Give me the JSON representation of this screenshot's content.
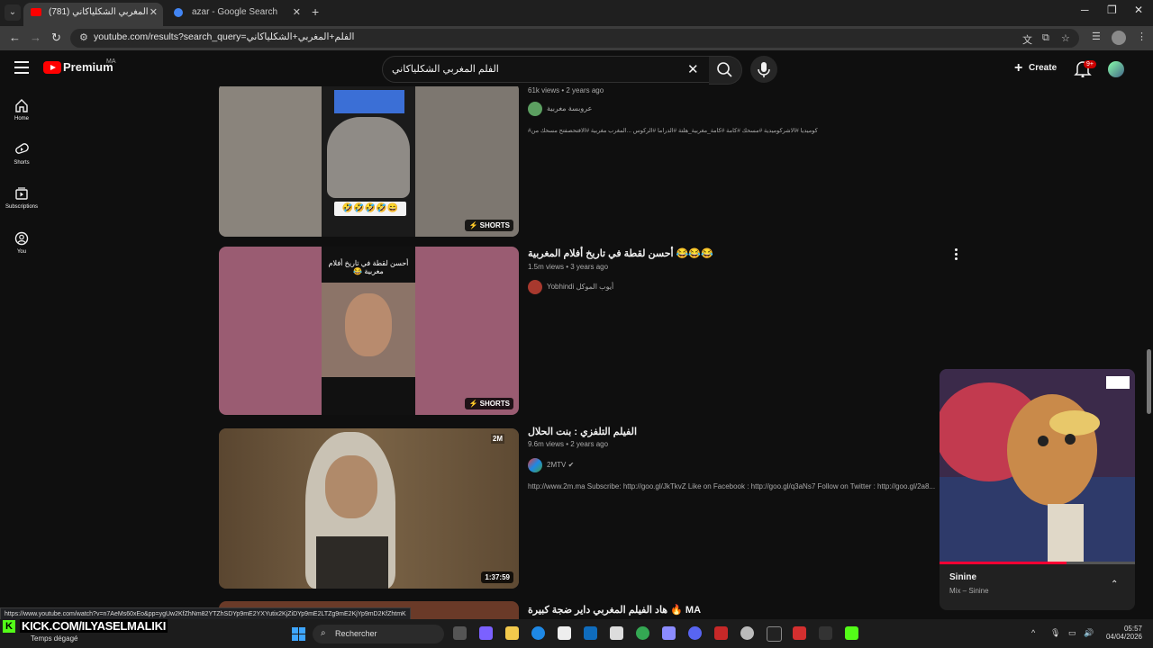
{
  "browser": {
    "tabs": [
      {
        "title": "(781) الفلم المغربي الشكلياكاني",
        "active": true
      },
      {
        "title": "azar - Google Search",
        "active": false
      }
    ],
    "url": "youtube.com/results?search_query=الفلم+المغربي+الشكلياكاني",
    "status_url": "https://www.youtube.com/watch?v=n7AeMs60xEo&pp=ygUw2KfZhNm82YTZhSDYp9mE2YXYutix2KjZiDYp9mE2LTZg9mE2KjYp9mD2KfZhtmK"
  },
  "youtube": {
    "premium_label": "Premium",
    "country": "MA",
    "search_query": "الفلم المغربي الشكلياكاني",
    "create_label": "Create",
    "notification_count": "9+",
    "sidebar": [
      {
        "label": "Home",
        "icon": "home-icon"
      },
      {
        "label": "Shorts",
        "icon": "shorts-icon"
      },
      {
        "label": "Subscriptions",
        "icon": "subscriptions-icon"
      },
      {
        "label": "You",
        "icon": "you-icon"
      }
    ],
    "results": [
      {
        "meta": "61k views • 2 years ago",
        "channel": "عروبسة مغربية",
        "description": "#كوميديا #الاشركوميدية #مسحك #كامة #كامة_مغربية_هلتة #الدراما #الركوس ...المغرب مغربية #الافتحصفتح مسحك من",
        "badge": "SHORTS"
      },
      {
        "title": "أحسن لقطة في تاريخ أفلام المغربية 😂😂😂",
        "meta": "1.5m views • 3 years ago",
        "channel": "Yobhindi أيوب الموكل",
        "badge": "SHORTS",
        "thumb_caption": "أحسن لقطة في تاريخ أفلام مغربية 😂"
      },
      {
        "title": "الفيلم التلفزي : بنت الحلال",
        "meta": "9.6m views • 2 years ago",
        "channel": "2MTV",
        "description": "http://www.2m.ma Subscribe: http://goo.gl/JkTkvZ Like on Facebook : http://goo.gl/q3aNs7 Follow on Twitter : http://goo.gl/2a8...",
        "duration": "1:37:59",
        "thumb_logo": "2M"
      },
      {
        "title": "هاد الفيلم المغربي داير ضجة كبيرة 🔥 MA"
      }
    ],
    "miniplayer": {
      "title": "Sinine",
      "subtitle": "Mix – Sinine",
      "progress": 0.65
    }
  },
  "taskbar": {
    "stream_overlay": "KICK.COM/ILYASELMALIKI",
    "weather": "Temps dégagé",
    "search_label": "Rechercher",
    "time": "05:57",
    "date": "04/04/2026"
  }
}
